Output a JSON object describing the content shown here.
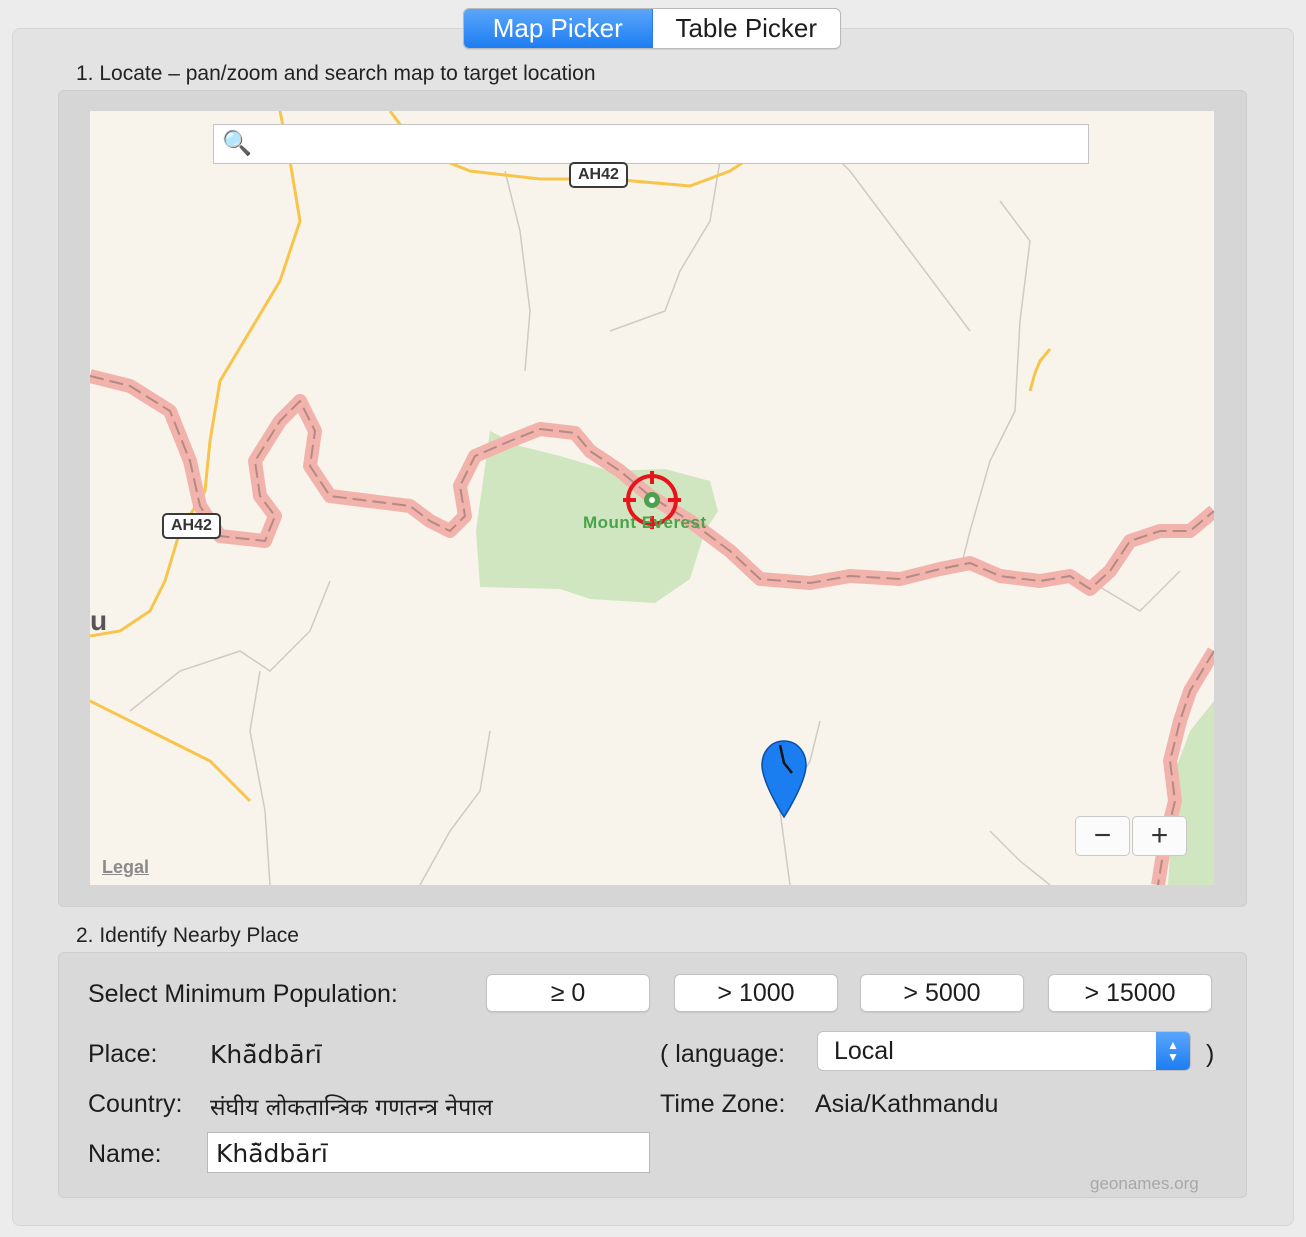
{
  "tabs": {
    "map_picker": "Map Picker",
    "table_picker": "Table Picker"
  },
  "step1": {
    "label": "1. Locate – pan/zoom and search map to target location"
  },
  "map": {
    "search_placeholder": "",
    "road_badge": "AH42",
    "poi_label": "Mount Everest",
    "city_fragment": "u",
    "legal": "Legal",
    "zoom_out": "−",
    "zoom_in": "+",
    "colors": {
      "land": "#f8f4ec",
      "park": "#cfe6c0",
      "border": "#f2b3ac",
      "road": "#f7c44c",
      "pin": "#1a7df0",
      "target": "#e8141c"
    }
  },
  "step2": {
    "label": "2. Identify Nearby Place"
  },
  "population": {
    "label": "Select Minimum Population:",
    "options": [
      "≥ 0",
      "> 1000",
      "> 5000",
      "> 15000"
    ]
  },
  "place": {
    "label": "Place:",
    "value": "Khā̃dbārī"
  },
  "country": {
    "label": "Country:",
    "value": "संघीय लोकतान्त्रिक गणतन्त्र नेपाल"
  },
  "name": {
    "label": "Name:",
    "value": "Khā̃dbārī"
  },
  "language": {
    "open": "( language:",
    "selected": "Local",
    "close": ")"
  },
  "timezone": {
    "label": "Time Zone:",
    "value": "Asia/Kathmandu"
  },
  "credit": "geonames.org"
}
